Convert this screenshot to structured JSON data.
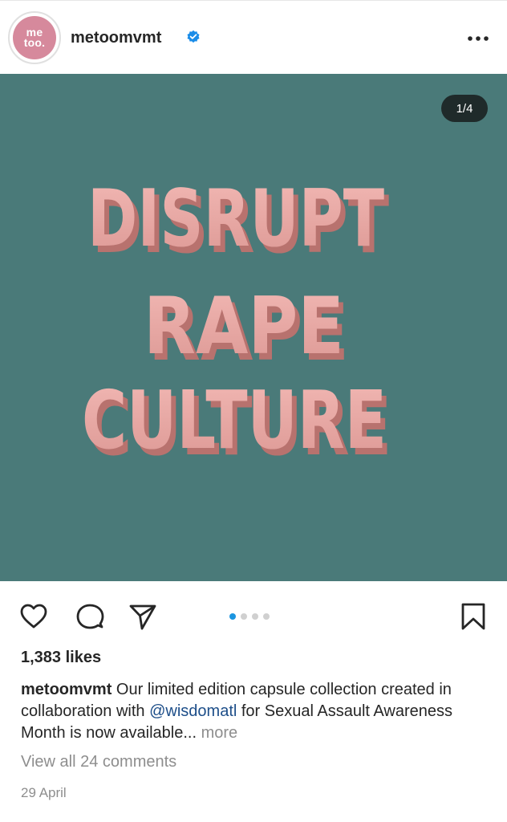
{
  "post": {
    "account": {
      "username": "metoomvmt",
      "avatar_text_line1": "me",
      "avatar_text_line2": "too.",
      "avatar_color": "#d6899c",
      "verified": true
    },
    "media": {
      "counter": "1/4",
      "background_color": "#4a7a79",
      "text_color": "#e9aaa6",
      "lines": [
        "DISRUPT",
        "RAPE",
        "CULTURE"
      ]
    },
    "carousel": {
      "total": 4,
      "active_index": 0
    },
    "likes": "1,383 likes",
    "caption": {
      "username": "metoomvmt",
      "text_before_mention": " Our limited edition capsule collection created in collaboration with ",
      "mention": "@wisdomatl",
      "text_after_mention": " for Sexual Assault Awareness Month is now available...",
      "more_label": " more"
    },
    "view_comments": "View all 24 comments",
    "date": "29 April",
    "icons": [
      "more-options-icon",
      "verified-badge-icon",
      "heart-icon",
      "comment-icon",
      "share-icon",
      "bookmark-icon"
    ]
  }
}
